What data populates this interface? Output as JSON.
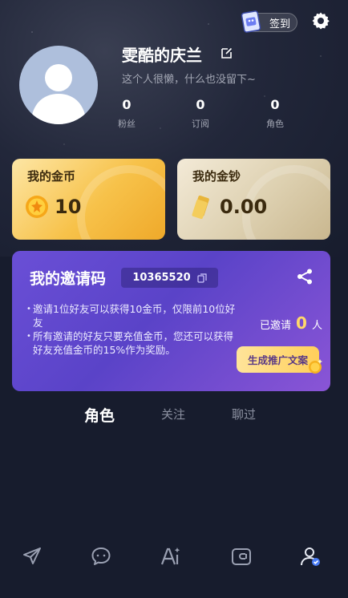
{
  "header": {
    "checkin_label": "签到",
    "checkin_icon": "calendar-icon",
    "settings_icon": "gear-icon"
  },
  "profile": {
    "username": "雯酷的庆兰",
    "bio": "这个人很懒，什么也没留下~",
    "stats": [
      {
        "value": "0",
        "label": "粉丝"
      },
      {
        "value": "0",
        "label": "订阅"
      },
      {
        "value": "0",
        "label": "角色"
      }
    ]
  },
  "wallet": {
    "coins_title": "我的金币",
    "coins_value": "10",
    "cash_title": "我的金钞",
    "cash_value": "0.00"
  },
  "invite": {
    "title": "我的邀请码",
    "code": "10365520",
    "rules": [
      "邀请1位好友可以获得10金币，仅限前10位好友",
      "所有邀请的好友只要充值金币，您还可以获得好友充值金币的15%作为奖励。"
    ],
    "invited_prefix": "已邀请",
    "invited_count": "0",
    "invited_suffix": "人",
    "promo_button": "生成推广文案"
  },
  "tabs": [
    {
      "label": "角色",
      "active": true
    },
    {
      "label": "关注",
      "active": false
    },
    {
      "label": "聊过",
      "active": false
    }
  ],
  "bottom_nav": [
    "send-icon",
    "chat-icon",
    "ai-create-icon",
    "wallet-icon",
    "profile-icon"
  ],
  "colors": {
    "background": "#171c2d",
    "invite_purple": "#6a4fd6",
    "coin_gold": "#f7c24a",
    "accent_blue": "#4a7cf5",
    "highlight_yellow": "#ffd86a"
  }
}
